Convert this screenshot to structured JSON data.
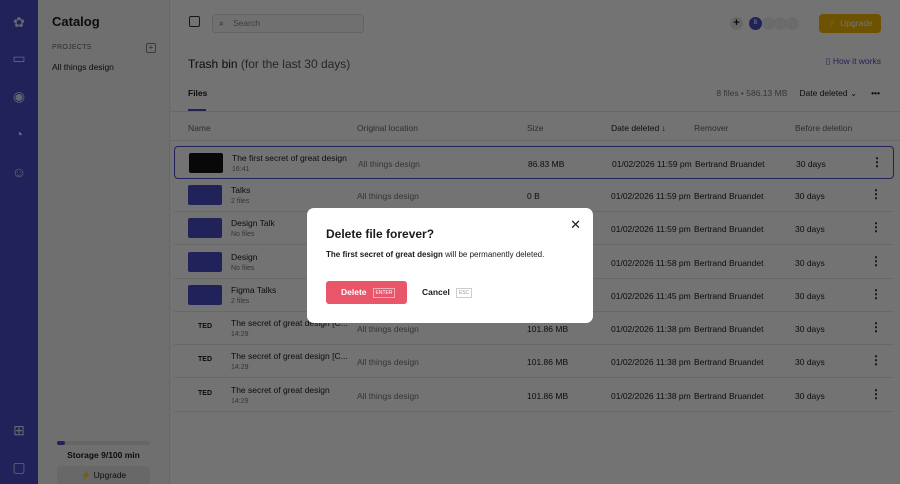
{
  "sidebar": {
    "title": "Catalog",
    "projects_label": "PROJECTS",
    "project": "All things design",
    "storage": "Storage 9/100 min",
    "storage_fraction": 0.09,
    "upgrade": "Upgrade"
  },
  "topbar": {
    "search_placeholder": "Search",
    "avatar": "B",
    "upgrade": "Upgrade"
  },
  "page": {
    "title": "Trash bin",
    "subtitle": "(for the last 30 days)",
    "how": "How it works",
    "tab": "Files",
    "meta": "8 files • 586.13 MB",
    "sort": "Date deleted"
  },
  "columns": [
    "Name",
    "Original location",
    "Size",
    "Date deleted",
    "Remover",
    "Before deletion"
  ],
  "rows": [
    {
      "name": "The first secret of great design",
      "sub": "16:41",
      "loc": "All things design",
      "size": "86.83 MB",
      "date": "01/02/2026 11:59 pm",
      "remover": "Bertrand Bruandet",
      "before": "30 days",
      "type": "video"
    },
    {
      "name": "Talks",
      "sub": "2 files",
      "loc": "All things design",
      "size": "0 B",
      "date": "01/02/2026 11:59 pm",
      "remover": "Bertrand Bruandet",
      "before": "30 days",
      "type": "folder"
    },
    {
      "name": "Design Talk",
      "sub": "No files",
      "date": "01/02/2026 11:59 pm",
      "remover": "Bertrand Bruandet",
      "before": "30 days",
      "type": "folder"
    },
    {
      "name": "Design",
      "sub": "No files",
      "date": "01/02/2026 11:58 pm",
      "remover": "Bertrand Bruandet",
      "before": "30 days",
      "type": "folder"
    },
    {
      "name": "Figma Talks",
      "sub": "2 files",
      "date": "01/02/2026 11:45 pm",
      "remover": "Bertrand Bruandet",
      "before": "30 days",
      "type": "folder"
    },
    {
      "name": "The secret of great design [C...",
      "sub": "14:29",
      "loc": "All things design",
      "size": "101.86 MB",
      "date": "01/02/2026 11:38 pm",
      "remover": "Bertrand Bruandet",
      "before": "30 days",
      "type": "ted"
    },
    {
      "name": "The secret of great design [C...",
      "sub": "14:29",
      "loc": "All things design",
      "size": "101.86 MB",
      "date": "01/02/2026 11:38 pm",
      "remover": "Bertrand Bruandet",
      "before": "30 days",
      "type": "ted"
    },
    {
      "name": "The secret of great design",
      "sub": "14:29",
      "loc": "All things design",
      "size": "101.86 MB",
      "date": "01/02/2026 11:38 pm",
      "remover": "Bertrand Bruandet",
      "before": "30 days",
      "type": "ted"
    }
  ],
  "ted_label": "TED",
  "modal": {
    "title": "Delete file forever?",
    "file": "The first secret of great design",
    "message": " will be permanently deleted.",
    "delete": "Delete",
    "delete_key": "ENTER",
    "cancel": "Cancel",
    "cancel_key": "ESC"
  }
}
